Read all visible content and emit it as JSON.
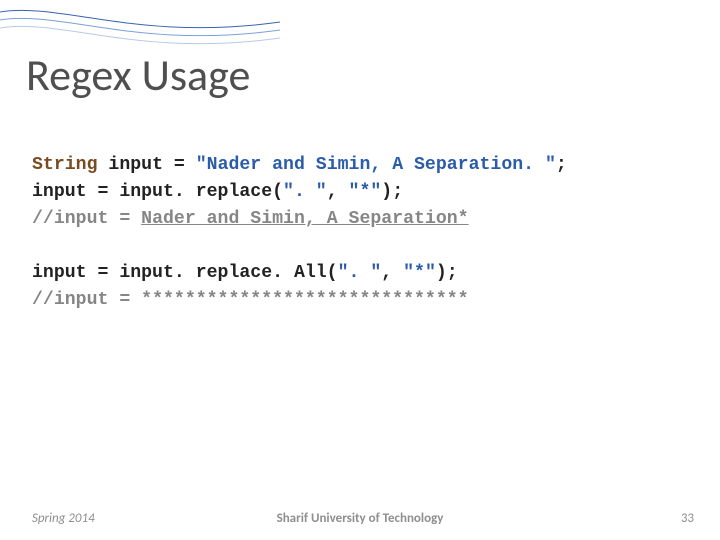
{
  "title": "Regex Usage",
  "code": {
    "l1a": "String ",
    "l1b": "input = ",
    "l1c": "\"Nader and Simin, A Separation. \"",
    "l1d": ";",
    "l2a": "input = input. replace(",
    "l2b": "\". \"",
    "l2c": ", ",
    "l2d": "\"*\"",
    "l2e": ");",
    "l3a": "//input = ",
    "l3b": "Nader and Simin, A Separation*",
    "l4a": "input = input. replace. All(",
    "l4b": "\". \"",
    "l4c": ", ",
    "l4d": "\"*\"",
    "l4e": ");",
    "l5a": "//input = ",
    "l5b": "******************************"
  },
  "footer": {
    "left": "Spring 2014",
    "center": "Sharif University of Technology",
    "right": "33"
  }
}
